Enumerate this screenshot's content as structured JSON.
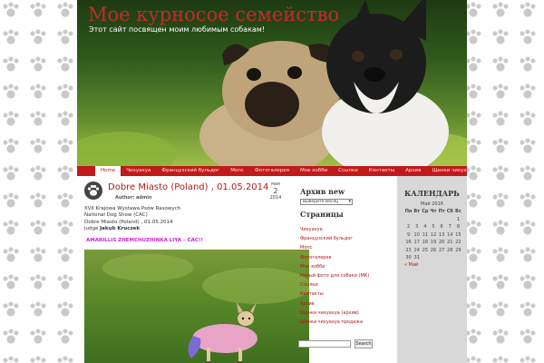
{
  "site": {
    "title": "Мое курносое семейство",
    "description": "Этот сайт посвящен моим любимым собакам!"
  },
  "nav": {
    "items": [
      {
        "label": "Home",
        "active": true
      },
      {
        "label": "Чихуахуа",
        "active": false
      },
      {
        "label": "Французский бульдог",
        "active": false
      },
      {
        "label": "Мопс",
        "active": false
      },
      {
        "label": "Фотогалерея",
        "active": false
      },
      {
        "label": "Мое хобби",
        "active": false
      },
      {
        "label": "Ссылки",
        "active": false
      },
      {
        "label": "Контакты",
        "active": false
      },
      {
        "label": "Архив",
        "active": false
      },
      {
        "label": "Щенки чихуахуа продажа",
        "active": false
      }
    ]
  },
  "post": {
    "title": "Dobre Miasto (Poland) , 01.05.2014",
    "author": "Author: admin",
    "date": {
      "month": "мая",
      "day": "2",
      "year": "2014"
    },
    "lines": [
      "XVII Krajowa Wystawa Psów Rasowych",
      "National Dog Show (CAC)",
      "Dobre Miasto (Poland) , 01.05.2014"
    ],
    "judge_prefix": "judge",
    "judge_name": "Jakub Kruczek",
    "highlight": "AMARILLIS ZHEMCHUZHINKA LIYA – CAC!!"
  },
  "sidebar": {
    "archive_title": "Архив new",
    "archive_select": "Выберите месяц",
    "pages_title": "Страницы",
    "pages": [
      "Чихуахуа",
      "Французский бульдог",
      "Мопс",
      "Фотогалерея",
      "Мое хобби",
      "Новый фото для собаки (МК)",
      "Ссылки",
      "Контакты",
      "Архив",
      "Щенки чихуахуа (архив)",
      "Щенки чихуахуа продажа"
    ],
    "search_button": "Search"
  },
  "calendar": {
    "title": "КАЛЕНДАРЬ",
    "month": "Май 2016",
    "headers": [
      "Пн",
      "Вт",
      "Ср",
      "Чт",
      "Пт",
      "Сб",
      "Вс"
    ],
    "weeks": [
      [
        "",
        "",
        "",
        "",
        "",
        "",
        "1"
      ],
      [
        "2",
        "3",
        "4",
        "5",
        "6",
        "7",
        "8"
      ],
      [
        "9",
        "10",
        "11",
        "12",
        "13",
        "14",
        "15"
      ],
      [
        "16",
        "17",
        "18",
        "19",
        "20",
        "21",
        "22"
      ],
      [
        "23",
        "24",
        "25",
        "26",
        "27",
        "28",
        "29"
      ],
      [
        "30",
        "31",
        "",
        "",
        "",
        "",
        ""
      ]
    ],
    "prev_link": "« Май"
  },
  "colors": {
    "accent": "#c01a1a",
    "highlight": "#cc22cc"
  },
  "icons": [
    "paw-icon",
    "chevron-down-icon"
  ]
}
